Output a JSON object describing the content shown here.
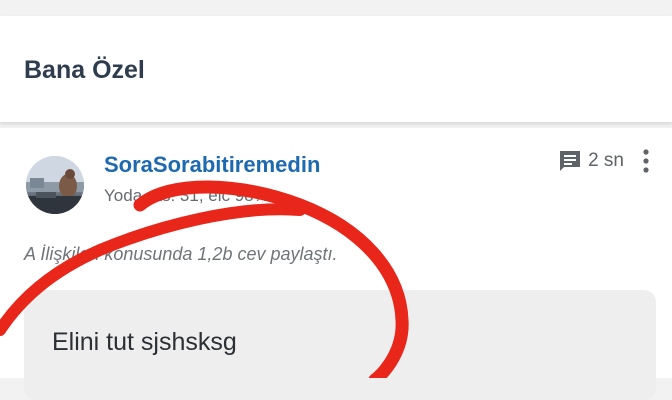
{
  "header": {
    "title": "Bana Özel"
  },
  "post": {
    "username": "SoraSorabitiremedin",
    "stats": "Yoda   ras: 31, eic 98%",
    "time": "2 sn",
    "activity": "A   İlişkileri konusunda 1,2b cev   paylaştı.",
    "answer": "Elini tut sjshsksg"
  },
  "icons": {
    "comment": "comment-icon",
    "more": "more-vertical-icon",
    "avatar": "avatar-photo"
  },
  "colors": {
    "title": "#2e3c4d",
    "username": "#1e6ab0",
    "scribble": "#e8261a",
    "answer_bg": "#eeeeee"
  }
}
